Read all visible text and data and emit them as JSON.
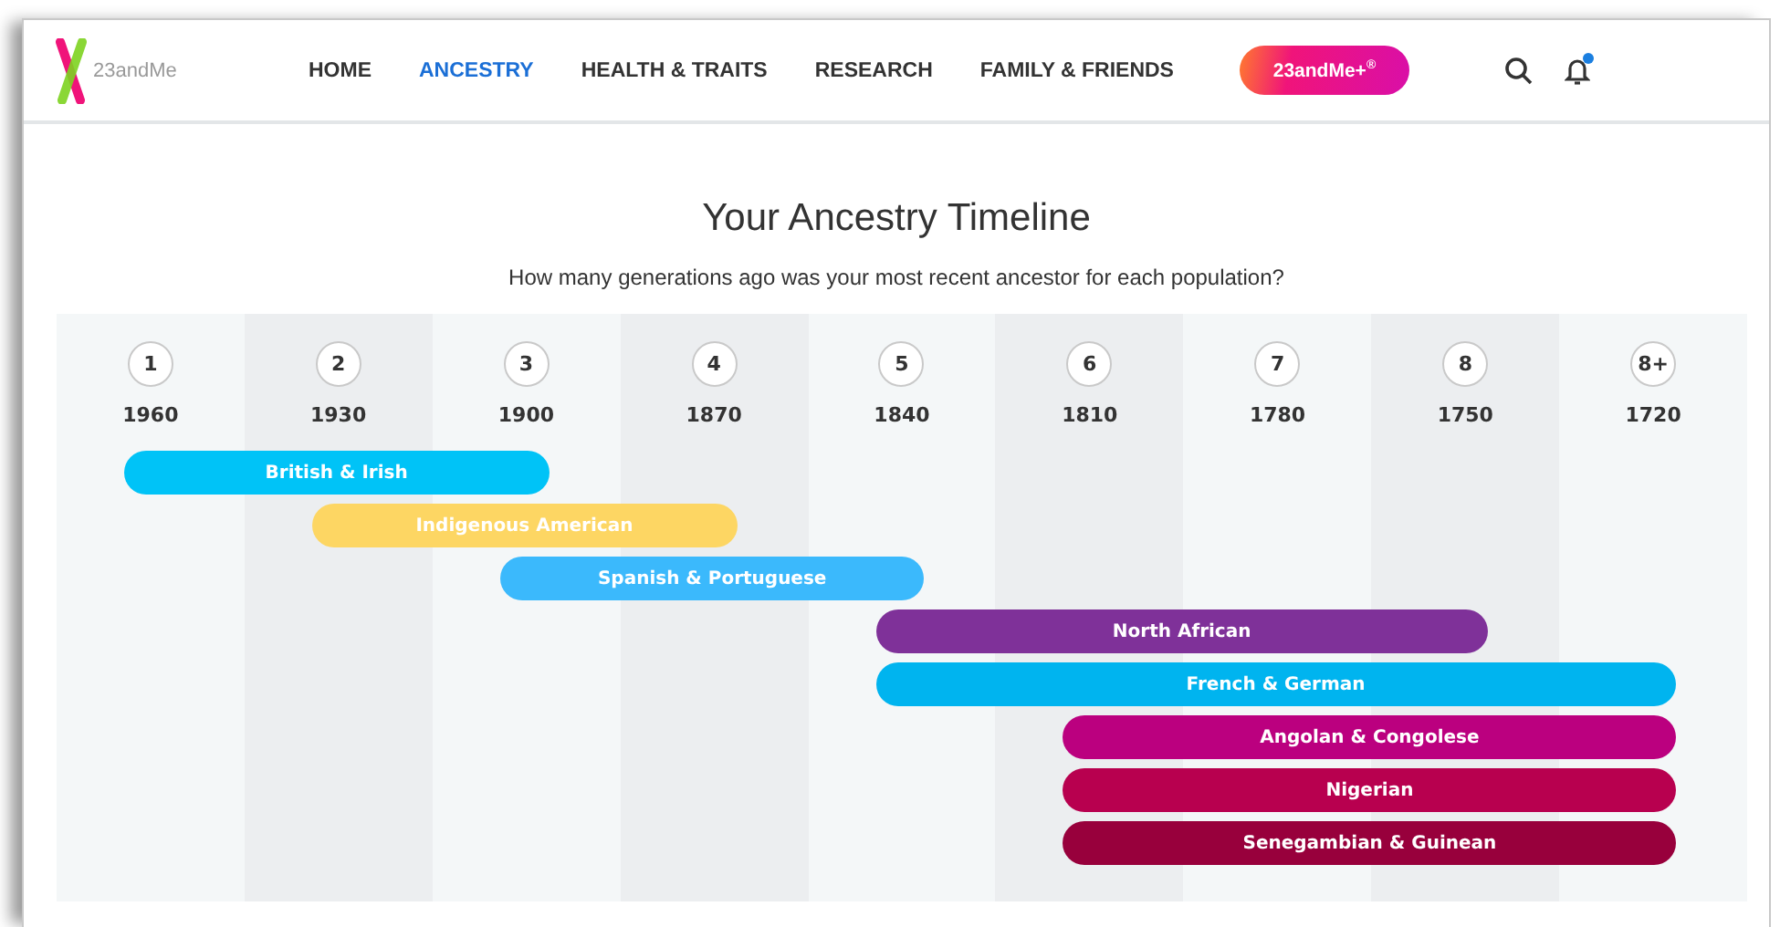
{
  "header": {
    "logo_text": "23andMe",
    "nav": [
      {
        "label": "HOME",
        "selected": false
      },
      {
        "label": "ANCESTRY",
        "selected": true
      },
      {
        "label": "HEALTH & TRAITS",
        "selected": false
      },
      {
        "label": "RESEARCH",
        "selected": false
      },
      {
        "label": "FAMILY & FRIENDS",
        "selected": false
      }
    ],
    "plus_button": "23andMe+$^{®}$",
    "has_notification": true
  },
  "title": "Your Ancestry Timeline",
  "subtitle": "How many generations ago was your most recent ancestor for each population?",
  "generations": [
    {
      "number": "1",
      "year": "1960"
    },
    {
      "number": "2",
      "year": "1930"
    },
    {
      "number": "3",
      "year": "1900"
    },
    {
      "number": "4",
      "year": "1870"
    },
    {
      "number": "5",
      "year": "1840"
    },
    {
      "number": "6",
      "year": "1810"
    },
    {
      "number": "7",
      "year": "1780"
    },
    {
      "number": "8",
      "year": "1750"
    },
    {
      "number": "8+",
      "year": "1720"
    }
  ],
  "populations": [
    {
      "name": "British & Irish",
      "color": "#00c3f7",
      "covers": [
        true,
        true,
        true,
        false,
        false,
        false,
        false,
        false,
        false
      ]
    },
    {
      "name": "Indigenous American",
      "color": "#fdd663",
      "covers": [
        false,
        true,
        true,
        true,
        false,
        false,
        false,
        false,
        false
      ]
    },
    {
      "name": "Spanish & Portuguese",
      "color": "#3bb9fc",
      "covers": [
        false,
        false,
        true,
        true,
        true,
        false,
        false,
        false,
        false
      ]
    },
    {
      "name": "North African",
      "color": "#7f3199",
      "covers": [
        false,
        false,
        false,
        false,
        true,
        true,
        true,
        true,
        false
      ]
    },
    {
      "name": "French & German",
      "color": "#00b4ef",
      "covers": [
        false,
        false,
        false,
        false,
        true,
        true,
        true,
        true,
        true
      ]
    },
    {
      "name": "Angolan & Congolese",
      "color": "#bb007f",
      "covers": [
        false,
        false,
        false,
        false,
        false,
        true,
        true,
        true,
        true
      ]
    },
    {
      "name": "Nigerian",
      "color": "#b8004f",
      "covers": [
        false,
        false,
        false,
        false,
        false,
        true,
        true,
        true,
        true
      ]
    },
    {
      "name": "Senegambian & Guinean",
      "color": "#98003c",
      "covers": [
        false,
        false,
        false,
        false,
        false,
        true,
        true,
        true,
        true
      ]
    }
  ]
}
